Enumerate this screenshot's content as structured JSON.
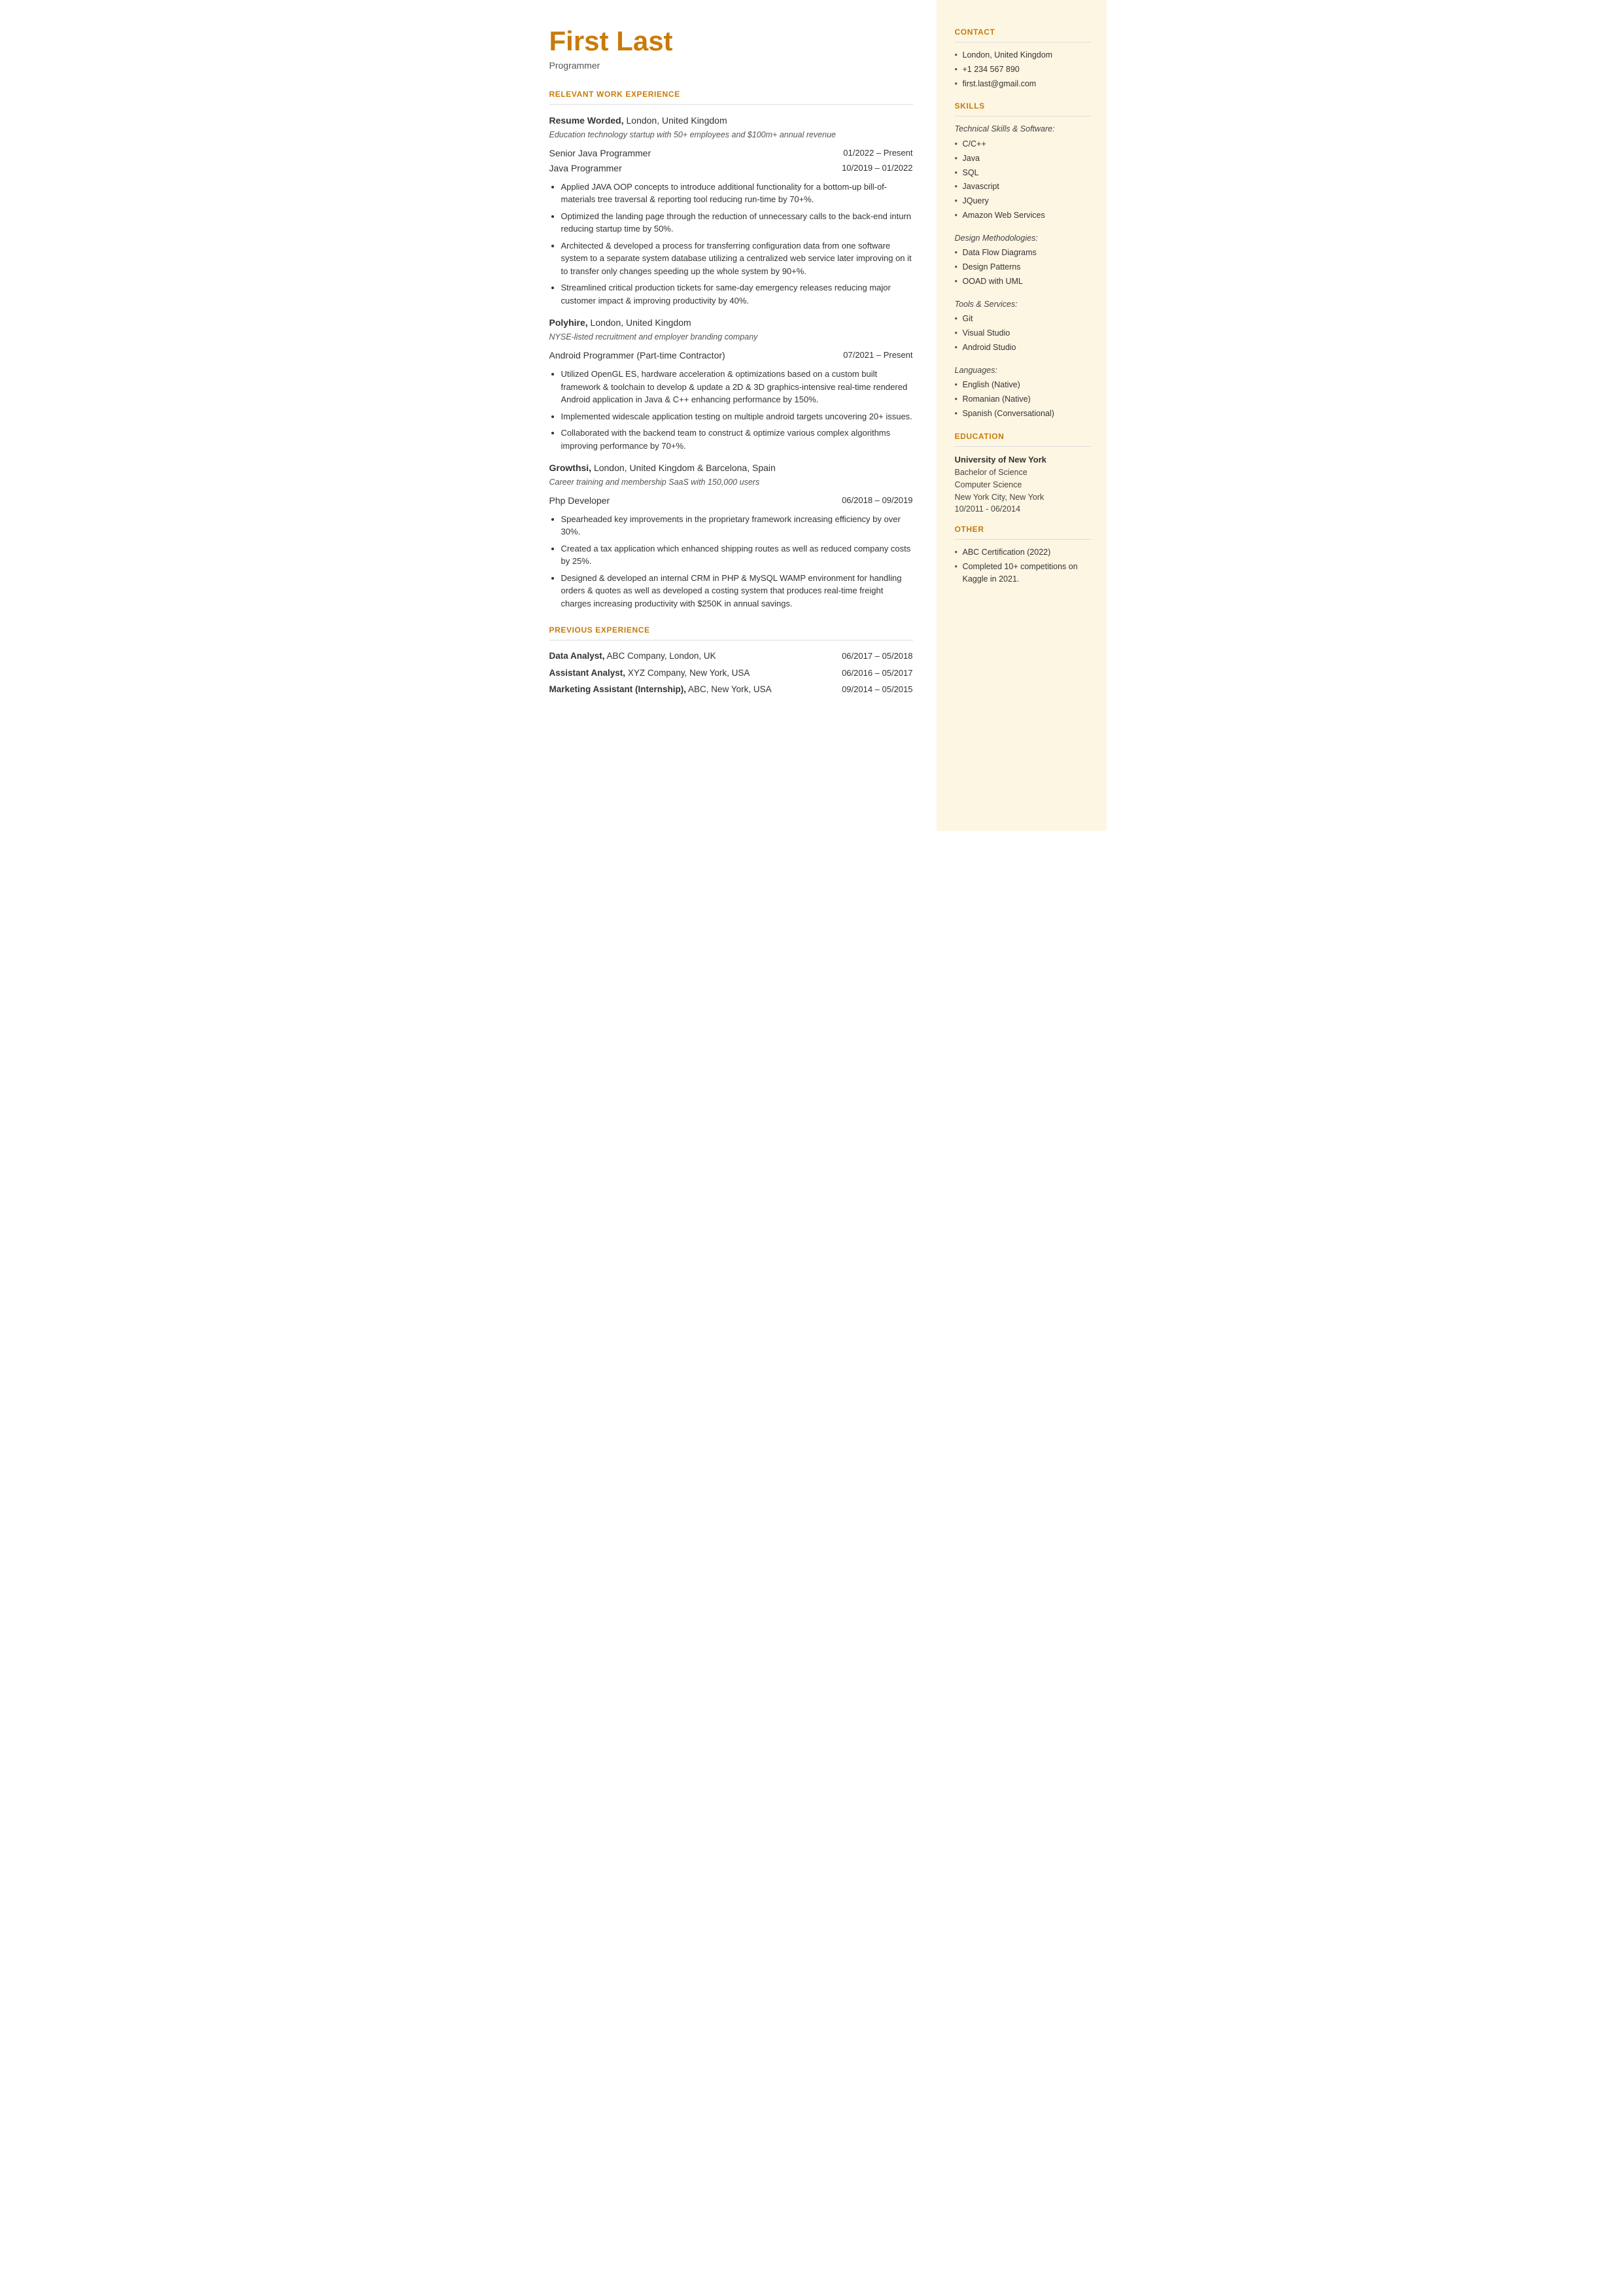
{
  "header": {
    "name": "First Last",
    "subtitle": "Programmer"
  },
  "sections": {
    "relevant_work_experience": {
      "label": "RELEVANT WORK EXPERIENCE",
      "companies": [
        {
          "name": "Resume Worded,",
          "name_suffix": " London, United Kingdom",
          "description": "Education technology startup with 50+ employees and $100m+ annual revenue",
          "roles": [
            {
              "title": "Senior Java Programmer",
              "dates": "01/2022 – Present"
            },
            {
              "title": "Java Programmer",
              "dates": "10/2019 – 01/2022"
            }
          ],
          "bullets": [
            "Applied JAVA OOP concepts to introduce additional functionality for a bottom-up bill-of-materials tree traversal & reporting tool reducing run-time by 70+%.",
            "Optimized the landing page through the reduction of unnecessary calls to the back-end inturn reducing startup time by 50%.",
            "Architected & developed a process for transferring configuration data from one software system to a separate system database utilizing a centralized web service later improving on it to transfer only changes speeding up the whole system by 90+%.",
            "Streamlined critical production tickets for same-day emergency releases reducing major customer impact & improving productivity by 40%."
          ]
        },
        {
          "name": "Polyhire,",
          "name_suffix": " London, United Kingdom",
          "description": "NYSE-listed recruitment and employer branding company",
          "roles": [
            {
              "title": "Android Programmer (Part-time Contractor)",
              "dates": "07/2021 – Present"
            }
          ],
          "bullets": [
            "Utilized OpenGL ES, hardware acceleration & optimizations based on a custom built framework & toolchain to develop & update a 2D & 3D graphics-intensive real-time rendered Android application in Java & C++ enhancing performance by 150%.",
            "Implemented widescale application testing on multiple android targets uncovering 20+ issues.",
            "Collaborated with the backend team to construct & optimize various complex algorithms improving performance by 70+%."
          ]
        },
        {
          "name": "Growthsi,",
          "name_suffix": " London, United Kingdom & Barcelona, Spain",
          "description": "Career training and membership SaaS with 150,000 users",
          "roles": [
            {
              "title": "Php Developer",
              "dates": "06/2018 – 09/2019"
            }
          ],
          "bullets": [
            "Spearheaded key improvements in the proprietary framework increasing efficiency by over 30%.",
            "Created a tax application which enhanced shipping routes as well as reduced company costs by 25%.",
            "Designed & developed an internal CRM in PHP & MySQL WAMP environment for handling orders & quotes as well as developed a costing system that produces real-time freight charges increasing productivity with $250K in annual savings."
          ]
        }
      ]
    },
    "previous_experience": {
      "label": "PREVIOUS EXPERIENCE",
      "entries": [
        {
          "title": "Data Analyst,",
          "company": " ABC Company, London, UK",
          "dates": "06/2017 – 05/2018"
        },
        {
          "title": "Assistant Analyst,",
          "company": " XYZ Company, New York, USA",
          "dates": "06/2016 – 05/2017"
        },
        {
          "title": "Marketing Assistant (Internship),",
          "company": " ABC, New York, USA",
          "dates": "09/2014 – 05/2015"
        }
      ]
    }
  },
  "sidebar": {
    "contact": {
      "label": "CONTACT",
      "items": [
        "London, United Kingdom",
        "+1 234 567 890",
        "first.last@gmail.com"
      ]
    },
    "skills": {
      "label": "SKILLS",
      "categories": [
        {
          "label": "Technical Skills & Software:",
          "items": [
            "C/C++",
            "Java",
            "SQL",
            "Javascript",
            "JQuery",
            "Amazon Web Services"
          ]
        },
        {
          "label": "Design Methodologies:",
          "items": [
            "Data Flow Diagrams",
            "Design Patterns",
            "OOAD with UML"
          ]
        },
        {
          "label": "Tools & Services:",
          "items": [
            "Git",
            "Visual Studio",
            "Android Studio"
          ]
        },
        {
          "label": "Languages:",
          "items": [
            "English (Native)",
            "Romanian (Native)",
            "Spanish (Conversational)"
          ]
        }
      ]
    },
    "education": {
      "label": "EDUCATION",
      "entries": [
        {
          "institution": "University of New York",
          "degree": "Bachelor of Science",
          "field": "Computer Science",
          "location": "New York City, New York",
          "dates": "10/2011 - 06/2014"
        }
      ]
    },
    "other": {
      "label": "OTHER",
      "items": [
        "ABC Certification (2022)",
        "Completed 10+ competitions on Kaggle in 2021."
      ]
    }
  }
}
